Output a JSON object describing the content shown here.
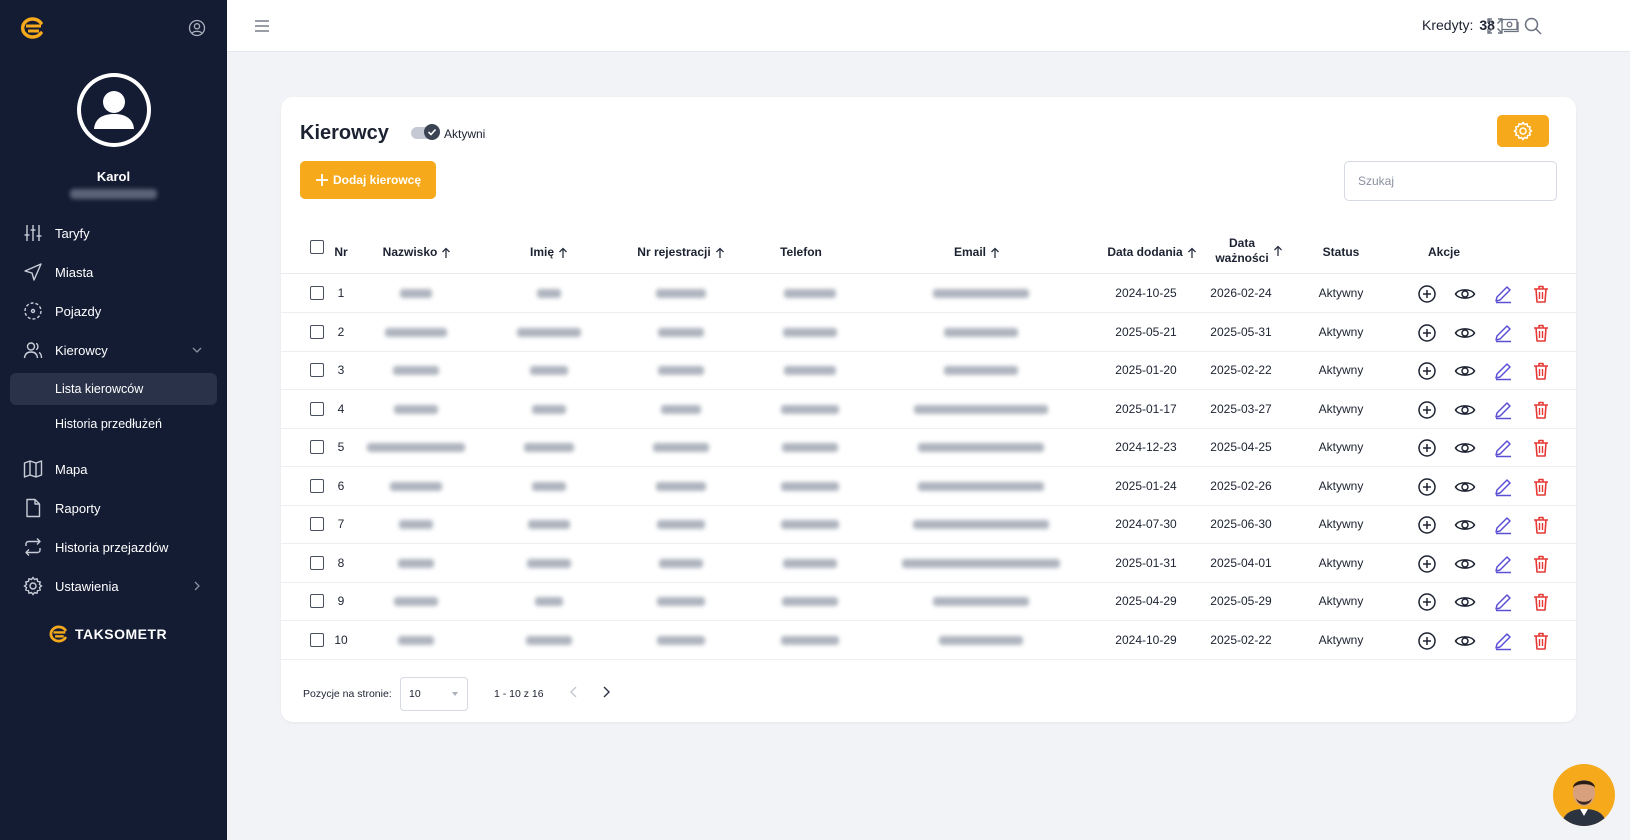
{
  "sidebar": {
    "user_name": "Karol",
    "brand": "TAKSOMETR",
    "items": [
      {
        "label": "Taryfy",
        "icon": "sliders-icon"
      },
      {
        "label": "Miasta",
        "icon": "navigation-icon"
      },
      {
        "label": "Pojazdy",
        "icon": "vehicle-scan-icon"
      },
      {
        "label": "Kierowcy",
        "icon": "users-icon"
      },
      {
        "label": "Mapa",
        "icon": "map-icon"
      },
      {
        "label": "Raporty",
        "icon": "file-icon"
      },
      {
        "label": "Historia przejazdów",
        "icon": "repeat-icon"
      },
      {
        "label": "Ustawienia",
        "icon": "gear-icon"
      }
    ],
    "submenu": [
      {
        "label": "Lista kierowców",
        "active": true
      },
      {
        "label": "Historia przedłużeń",
        "active": false
      }
    ]
  },
  "topbar": {
    "credits_label": "Kredyty:",
    "credits_value": "38"
  },
  "page": {
    "title": "Kierowcy",
    "toggle_label": "Aktywni",
    "toggle_on": true,
    "add_button": "Dodaj kierowcę",
    "search_placeholder": "Szukaj"
  },
  "colors": {
    "accent": "#f5a91b",
    "sidebar_bg": "#141c34",
    "delete": "#e53935",
    "edit": "#5b4fd6"
  },
  "table": {
    "headers": {
      "nr": "Nr",
      "nazwisko": "Nazwisko",
      "imie": "Imię",
      "nr_rejestracji": "Nr rejestracji",
      "telefon": "Telefon",
      "email": "Email",
      "data_dodania": "Data dodania",
      "data_waznosci_1": "Data",
      "data_waznosci_2": "ważności",
      "status": "Status",
      "akcje": "Akcje"
    },
    "rows": [
      {
        "nr": "1",
        "data_dodania": "2024-10-25",
        "data_waznosci": "2026-02-24",
        "status": "Aktywny"
      },
      {
        "nr": "2",
        "data_dodania": "2025-05-21",
        "data_waznosci": "2025-05-31",
        "status": "Aktywny"
      },
      {
        "nr": "3",
        "data_dodania": "2025-01-20",
        "data_waznosci": "2025-02-22",
        "status": "Aktywny"
      },
      {
        "nr": "4",
        "data_dodania": "2025-01-17",
        "data_waznosci": "2025-03-27",
        "status": "Aktywny"
      },
      {
        "nr": "5",
        "data_dodania": "2024-12-23",
        "data_waznosci": "2025-04-25",
        "status": "Aktywny"
      },
      {
        "nr": "6",
        "data_dodania": "2025-01-24",
        "data_waznosci": "2025-02-26",
        "status": "Aktywny"
      },
      {
        "nr": "7",
        "data_dodania": "2024-07-30",
        "data_waznosci": "2025-06-30",
        "status": "Aktywny"
      },
      {
        "nr": "8",
        "data_dodania": "2025-01-31",
        "data_waznosci": "2025-04-01",
        "status": "Aktywny"
      },
      {
        "nr": "9",
        "data_dodania": "2025-04-29",
        "data_waznosci": "2025-05-29",
        "status": "Aktywny"
      },
      {
        "nr": "10",
        "data_dodania": "2024-10-29",
        "data_waznosci": "2025-02-22",
        "status": "Aktywny"
      }
    ]
  },
  "pagination": {
    "per_page_label": "Pozycje na stronie:",
    "per_page_value": "10",
    "range": "1 - 10 z 16"
  }
}
